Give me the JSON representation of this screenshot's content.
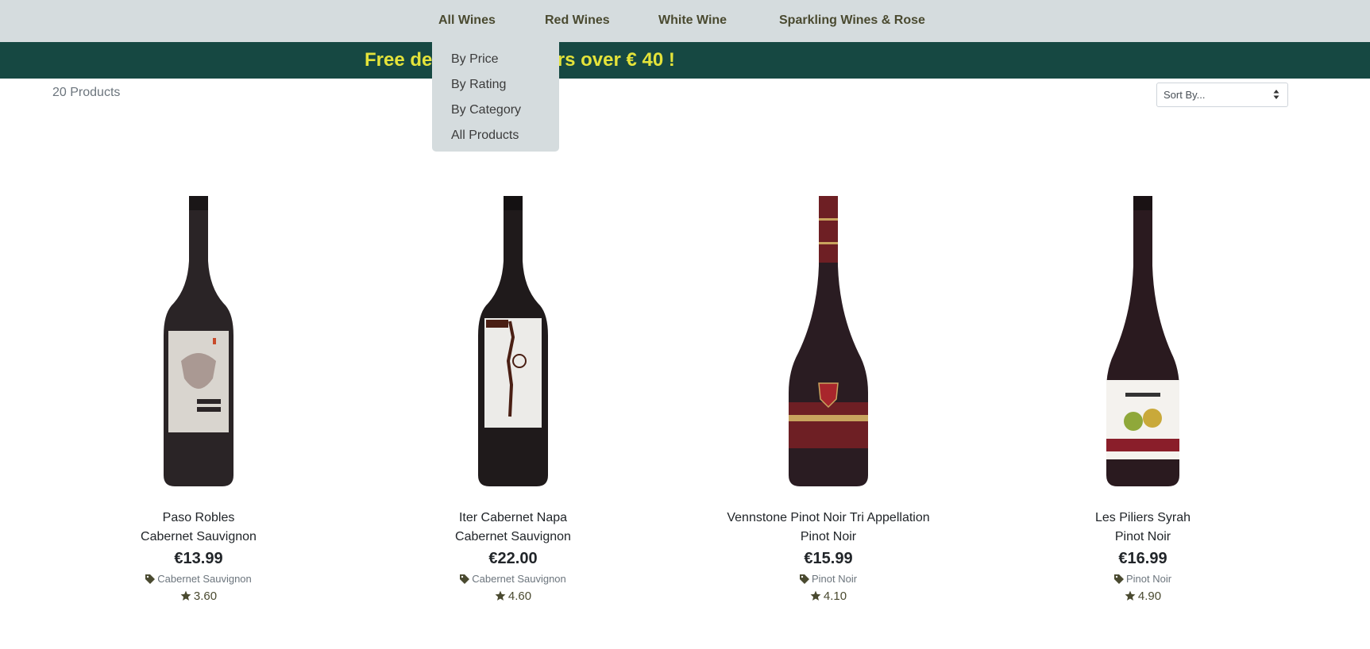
{
  "nav": {
    "items": [
      {
        "label": "All Wines"
      },
      {
        "label": "Red Wines"
      },
      {
        "label": "White Wine"
      },
      {
        "label": "Sparkling Wines & Rose"
      }
    ]
  },
  "banner": {
    "text": "Free delivery on orders over € 40 !"
  },
  "dropdown": {
    "items": [
      {
        "label": "By Price"
      },
      {
        "label": "By Rating"
      },
      {
        "label": "By Category"
      },
      {
        "label": "All Products"
      }
    ]
  },
  "results": {
    "count_text": "20 Products"
  },
  "sort": {
    "selected": "Sort By..."
  },
  "colors": {
    "nav_bg": "#d5dcde",
    "banner_bg": "#164842",
    "banner_text": "#e4e33a",
    "accent_dark": "#4a4a30"
  },
  "products": [
    {
      "name": "Paso Robles",
      "category_line": "Cabernet Sauvignon",
      "price": "€13.99",
      "category": "Cabernet Sauvignon",
      "rating": "3.60",
      "category_icon": "tag-icon",
      "rating_icon": "star-icon"
    },
    {
      "name": "Iter Cabernet Napa",
      "category_line": "Cabernet Sauvignon",
      "price": "€22.00",
      "category": "Cabernet Sauvignon",
      "rating": "4.60",
      "category_icon": "tag-icon",
      "rating_icon": "star-icon"
    },
    {
      "name": "Vennstone Pinot Noir Tri Appellation",
      "category_line": "Pinot Noir",
      "price": "€15.99",
      "category": "Pinot Noir",
      "rating": "4.10",
      "category_icon": "tag-icon",
      "rating_icon": "star-icon"
    },
    {
      "name": "Les Piliers Syrah",
      "category_line": "Pinot Noir",
      "price": "€16.99",
      "category": "Pinot Noir",
      "rating": "4.90",
      "category_icon": "tag-icon",
      "rating_icon": "star-icon"
    }
  ]
}
